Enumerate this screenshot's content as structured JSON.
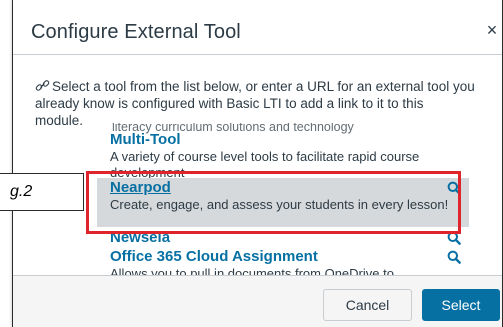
{
  "dialog": {
    "title": "Configure External Tool",
    "close_glyph": "×",
    "intro_icon": "link-icon",
    "intro_text": "Select a tool from the list below, or enter a URL for an external tool you already know is configured with Basic LTI to add a link to it to this module."
  },
  "tool_list": {
    "cut_off_text": "literacy curriculum solutions and technology",
    "items": [
      {
        "name": "Multi-Tool",
        "description": "A variety of course level tools to facilitate rapid course development",
        "selected": false,
        "icon": ""
      },
      {
        "name": "Nearpod",
        "description": "Create, engage, and assess your students in every lesson!",
        "selected": true,
        "icon": "search-icon"
      },
      {
        "name": "Newsela",
        "description": "",
        "selected": false,
        "icon": "search-icon"
      },
      {
        "name": "Office 365 Cloud Assignment",
        "description": "Allows you to pull in documents from OneDrive to",
        "selected": false,
        "icon": "search-icon"
      }
    ]
  },
  "footer": {
    "cancel_label": "Cancel",
    "select_label": "Select"
  },
  "annotation": {
    "figure_label": "g.2",
    "highlight_color": "#e0242b"
  },
  "colors": {
    "link_blue": "#0770a3",
    "text": "#2d3b45",
    "selected_bg": "#d6d9db",
    "footer_bg": "#f5f5f5"
  }
}
